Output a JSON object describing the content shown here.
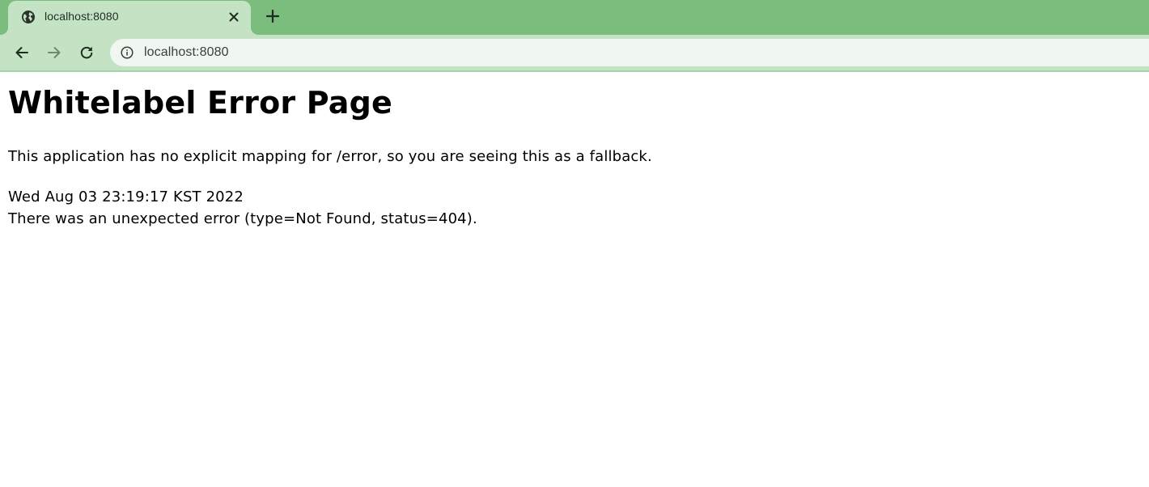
{
  "browser": {
    "tab": {
      "title": "localhost:8080",
      "favicon": "globe-icon",
      "close_icon": "close-icon"
    },
    "new_tab_icon": "plus-icon",
    "toolbar": {
      "back_icon": "arrow-left-icon",
      "forward_icon": "arrow-right-icon",
      "reload_icon": "reload-icon",
      "site_info_icon": "info-icon",
      "url": "localhost:8080"
    },
    "colors": {
      "tabstrip": "#7abd7c",
      "active_tab": "#c4e3c5",
      "toolbar": "#c4e3c5",
      "omnibox": "#eff7f0"
    }
  },
  "page": {
    "heading": "Whitelabel Error Page",
    "message": "This application has no explicit mapping for /error, so you are seeing this as a fallback.",
    "timestamp": "Wed Aug 03 23:19:17 KST 2022",
    "error_line": "There was an unexpected error (type=Not Found, status=404)."
  }
}
